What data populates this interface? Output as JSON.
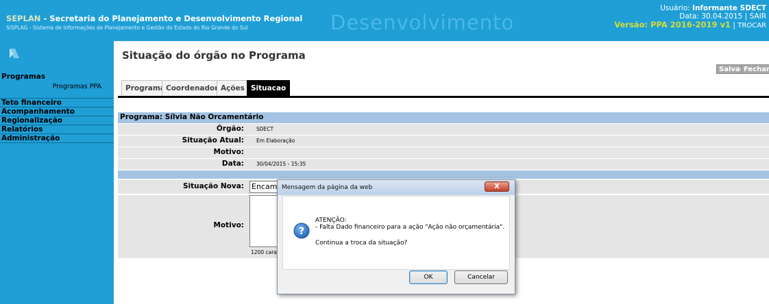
{
  "header": {
    "title_prefix": "SEPLAN",
    "title_rest": " - Secretaria do Planejamento e Desenvolvimento Regional",
    "subtitle": "SISPLAG - Sistema de Informações de Planejamento e Gestão do Estado do Rio Grande do Sul",
    "banner_text": "Desenvolvimento",
    "user_label": "Usuário:",
    "user_name": "Informante SDECT",
    "date_text": "Data: 30.04.2015",
    "sep1": " | ",
    "logout": "SAIR",
    "version": "Versão: PPA 2016-2019 v1",
    "sep2": " | ",
    "switch": "TROCAR"
  },
  "sidebar": {
    "section_label": "Programas",
    "subitem": "Programas PPA",
    "items": [
      "Teto financeiro",
      "Acompanhamento",
      "Regionalização",
      "Relatórios",
      "Administração"
    ]
  },
  "page": {
    "title": "Situação do órgão no Programa",
    "save": "Salvar",
    "close": "Fechar"
  },
  "tabs": [
    "Programa",
    "Coordenador",
    "Ações",
    "Situacao"
  ],
  "form": {
    "program_header": "Programa: Sílvia Não Orcamentário",
    "rows": [
      {
        "label": "Órgão:",
        "value": "SDECT"
      },
      {
        "label": "Situação Atual:",
        "value": "Em Elaboração"
      },
      {
        "label": "Motivo:",
        "value": ""
      },
      {
        "label": "Data:",
        "value": "30/04/2015 - 15:35"
      }
    ],
    "new_status_label": "Situação Nova:",
    "new_status_value": "Encaminhado",
    "motivo_label": "Motivo:",
    "chars_text": "1200 caracteres"
  },
  "dialog": {
    "title": "Mensagem da página da web",
    "close_glyph": "X",
    "line1": "ATENÇÃO:",
    "line2": "- Falta Dado financeiro para a ação \"Ação não orçamentária\".",
    "line3": "Continua a troca da situação?",
    "ok": "OK",
    "cancel": "Cancelar"
  },
  "colors": {
    "header_bg": "#1f9fd6",
    "row_blue": "#a4c3e2",
    "row_shaded": "#e5e5e5",
    "version_yellow": "#d4dc3c"
  }
}
